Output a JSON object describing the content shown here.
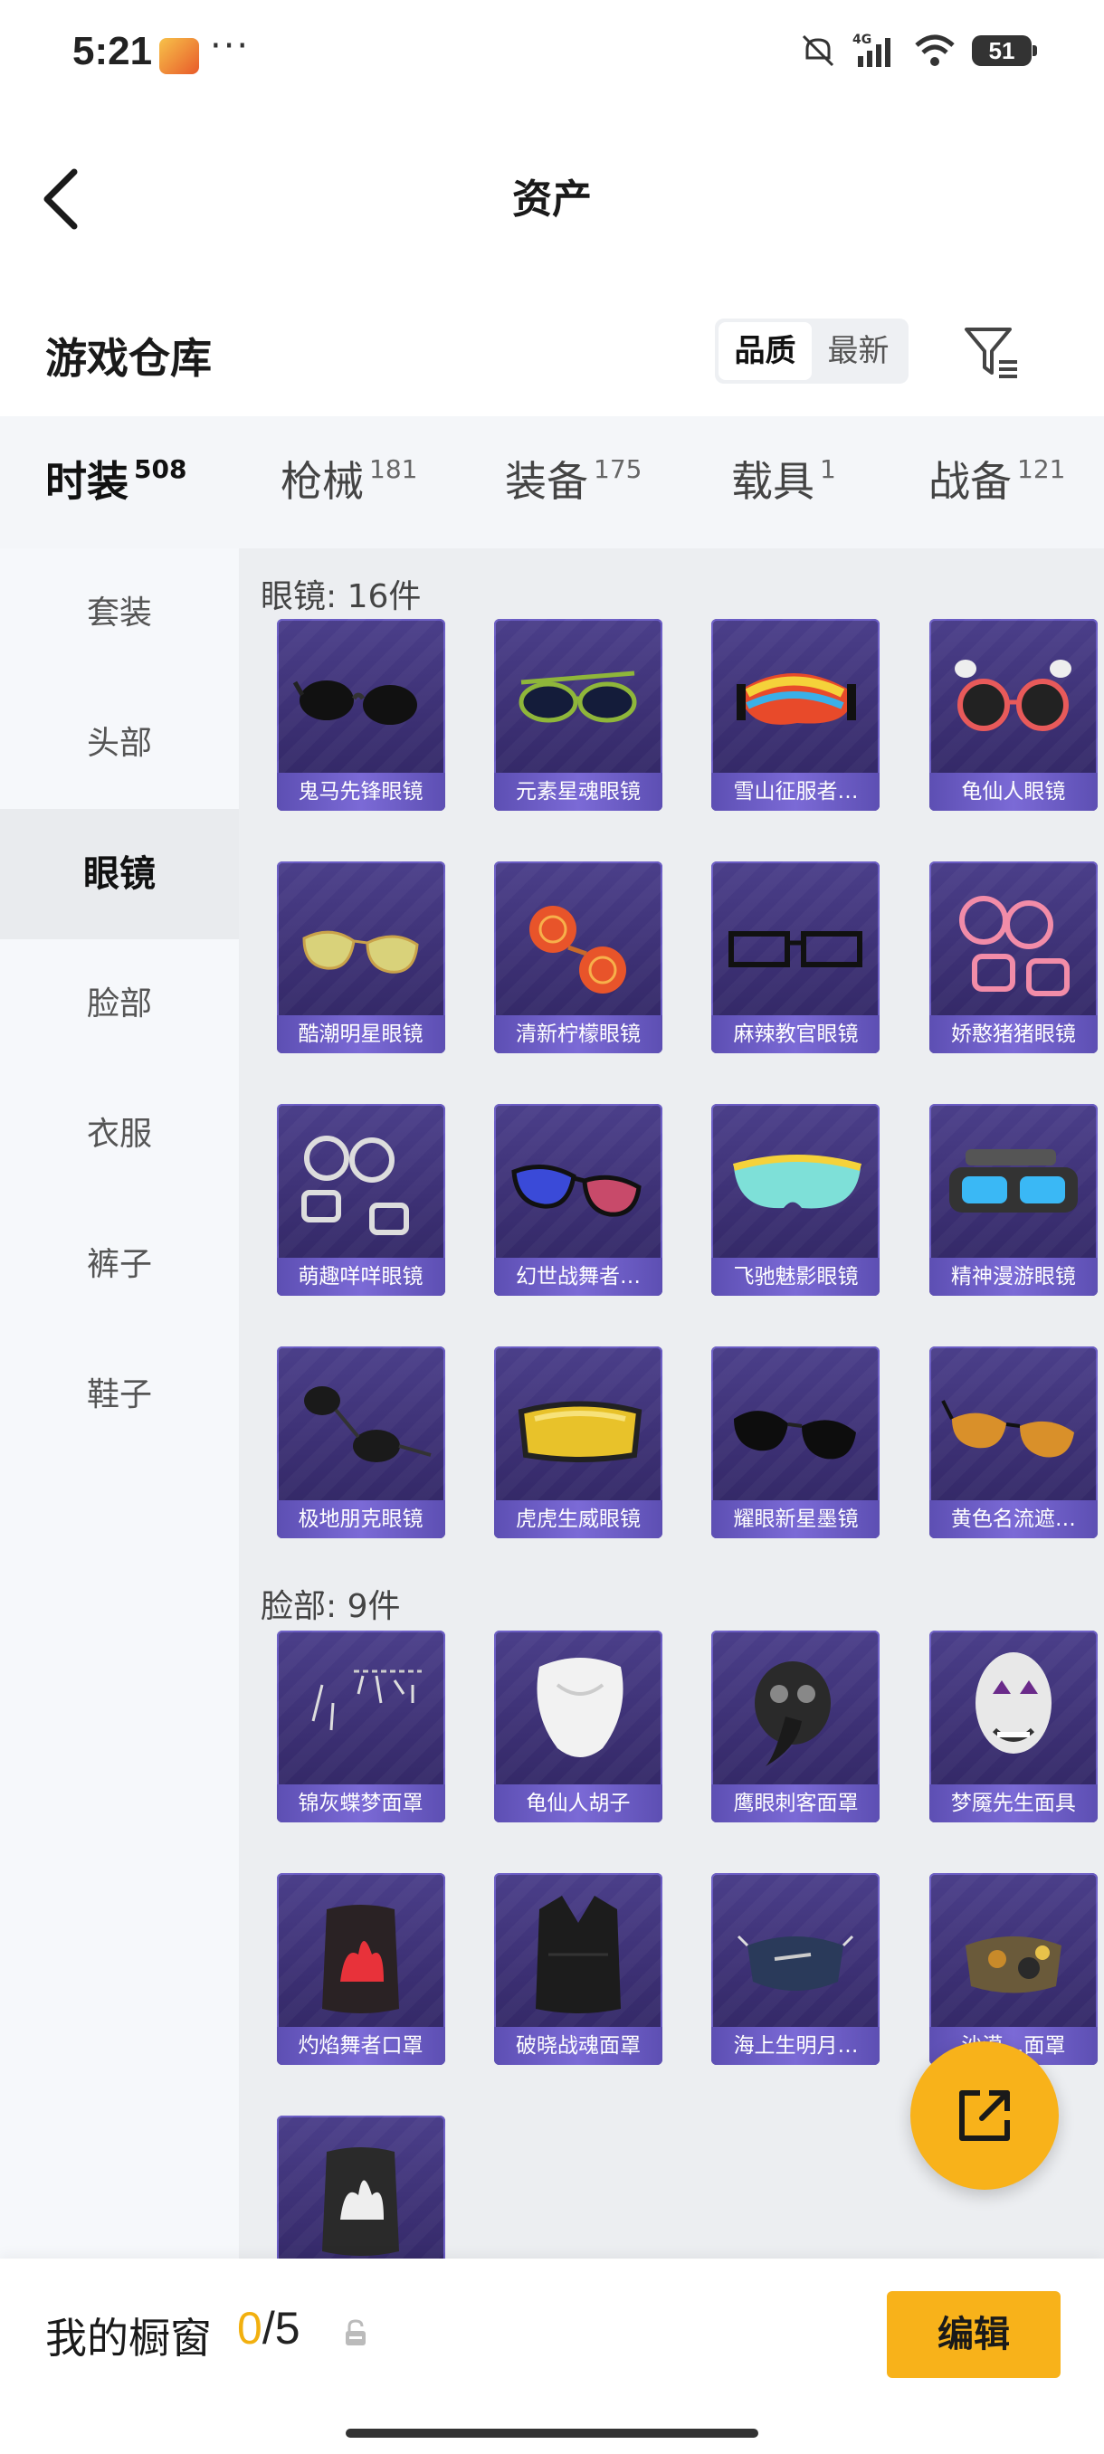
{
  "status_bar": {
    "time": "5:21",
    "dots": "···",
    "network": "4G",
    "battery": "51"
  },
  "header": {
    "title": "资产"
  },
  "warehouse": {
    "title": "游戏仓库",
    "sort_options": [
      "品质",
      "最新"
    ],
    "sort_active": "品质"
  },
  "category_tabs": [
    {
      "label": "时装",
      "count": "508",
      "active": true
    },
    {
      "label": "枪械",
      "count": "181",
      "active": false
    },
    {
      "label": "装备",
      "count": "175",
      "active": false
    },
    {
      "label": "载具",
      "count": "1",
      "active": false
    },
    {
      "label": "战备",
      "count": "121",
      "active": false
    }
  ],
  "left_nav": [
    {
      "label": "套装",
      "active": false
    },
    {
      "label": "头部",
      "active": false
    },
    {
      "label": "眼镜",
      "active": true
    },
    {
      "label": "脸部",
      "active": false
    },
    {
      "label": "衣服",
      "active": false
    },
    {
      "label": "裤子",
      "active": false
    },
    {
      "label": "鞋子",
      "active": false
    }
  ],
  "sections": [
    {
      "title": "眼镜: 16件",
      "items": [
        {
          "name": "鬼马先锋眼镜",
          "art": "sunglasses-dark"
        },
        {
          "name": "元素星魂眼镜",
          "art": "sunglasses-green"
        },
        {
          "name": "雪山征服者…",
          "art": "goggles-rainbow"
        },
        {
          "name": "龟仙人眼镜",
          "art": "glasses-red-round"
        },
        {
          "name": "酷潮明星眼镜",
          "art": "aviator-gold"
        },
        {
          "name": "清新柠檬眼镜",
          "art": "glasses-orange"
        },
        {
          "name": "麻辣教官眼镜",
          "art": "glasses-black-frame"
        },
        {
          "name": "娇憨猪猪眼镜",
          "art": "glasses-pink"
        },
        {
          "name": "萌趣咩咩眼镜",
          "art": "glasses-white"
        },
        {
          "name": "幻世战舞者…",
          "art": "sunglasses-blue"
        },
        {
          "name": "飞驰魅影眼镜",
          "art": "goggles-cyan"
        },
        {
          "name": "精神漫游眼镜",
          "art": "goggles-tech"
        },
        {
          "name": "极地朋克眼镜",
          "art": "sunglasses-punk"
        },
        {
          "name": "虎虎生威眼镜",
          "art": "ski-goggles-yellow"
        },
        {
          "name": "耀眼新星墨镜",
          "art": "sunglasses-black"
        },
        {
          "name": "黄色名流遮…",
          "art": "sunglasses-amber"
        }
      ]
    },
    {
      "title": "脸部: 9件",
      "items": [
        {
          "name": "锦灰蝶梦面罩",
          "art": "mask-butterfly"
        },
        {
          "name": "龟仙人胡子",
          "art": "white-beard"
        },
        {
          "name": "鹰眼刺客面罩",
          "art": "plague-mask"
        },
        {
          "name": "梦魇先生面具",
          "art": "clown-mask"
        },
        {
          "name": "灼焰舞者口罩",
          "art": "flame-gaiter"
        },
        {
          "name": "破晓战魂面罩",
          "art": "black-gaiter"
        },
        {
          "name": "海上生明月…",
          "art": "blue-mask"
        },
        {
          "name": "沙漠…面罩",
          "art": "camo-mask"
        },
        {
          "name": "",
          "art": "white-flame-gaiter"
        }
      ]
    }
  ],
  "bottom_bar": {
    "label": "我的橱窗",
    "current": "0",
    "total": "/5",
    "edit_label": "编辑"
  },
  "colors": {
    "accent": "#f8b21a",
    "card_bg": "#3b2f72",
    "label_bg": "#7b6ad6"
  }
}
